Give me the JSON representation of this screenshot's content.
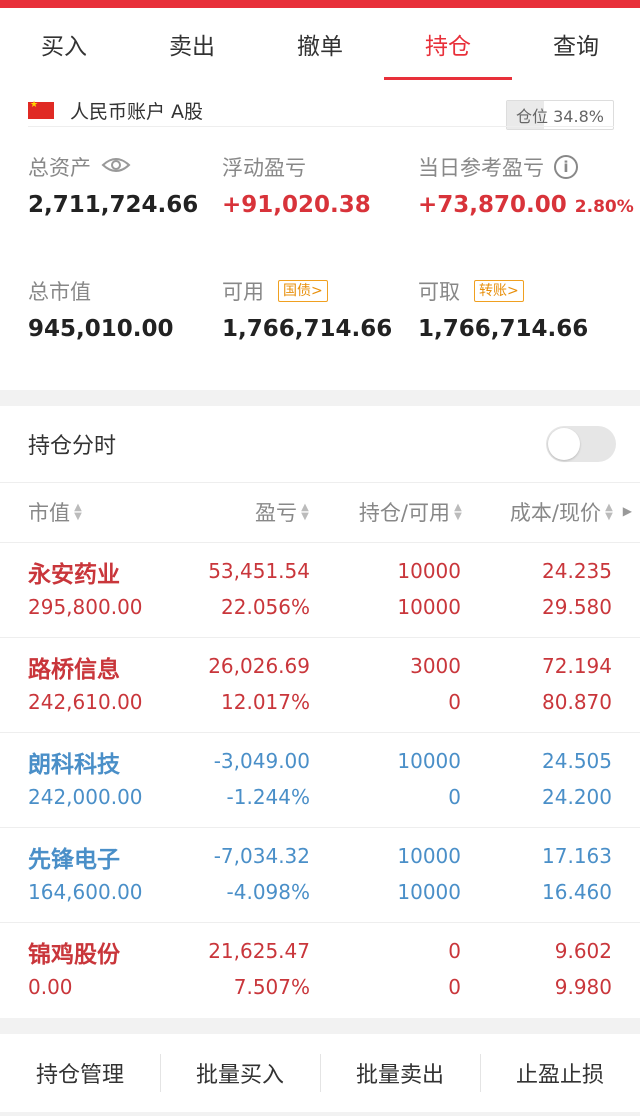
{
  "tabs": [
    {
      "label": "买入",
      "active": false
    },
    {
      "label": "卖出",
      "active": false
    },
    {
      "label": "撤单",
      "active": false
    },
    {
      "label": "持仓",
      "active": true
    },
    {
      "label": "查询",
      "active": false
    }
  ],
  "account": {
    "name": "人民币账户 A股",
    "position_label": "仓位 34.8%",
    "position_ratio": 0.348,
    "total_assets_label": "总资产",
    "total_assets": "2,711,724.66",
    "floating_pl_label": "浮动盈亏",
    "floating_pl": "+91,020.38",
    "today_pl_label": "当日参考盈亏",
    "today_pl": "+73,870.00",
    "today_pl_pct": "2.80%",
    "market_value_label": "总市值",
    "market_value": "945,010.00",
    "available_label": "可用",
    "available_chip": "国债>",
    "available": "1,766,714.66",
    "withdrawable_label": "可取",
    "withdrawable_chip": "转账>",
    "withdrawable": "1,766,714.66"
  },
  "holdings_time": {
    "label": "持仓分时",
    "enabled": false
  },
  "table": {
    "headers": [
      "市值",
      "盈亏",
      "持仓/可用",
      "成本/现价"
    ],
    "rows": [
      {
        "name": "永安药业",
        "market_value": "295,800.00",
        "pl": "53,451.54",
        "pl_pct": "22.056%",
        "holding": "10000",
        "available": "10000",
        "cost": "24.235",
        "price": "29.580",
        "color": "red"
      },
      {
        "name": "路桥信息",
        "market_value": "242,610.00",
        "pl": "26,026.69",
        "pl_pct": "12.017%",
        "holding": "3000",
        "available": "0",
        "cost": "72.194",
        "price": "80.870",
        "color": "red"
      },
      {
        "name": "朗科科技",
        "market_value": "242,000.00",
        "pl": "-3,049.00",
        "pl_pct": "-1.244%",
        "holding": "10000",
        "available": "0",
        "cost": "24.505",
        "price": "24.200",
        "color": "blue"
      },
      {
        "name": "先锋电子",
        "market_value": "164,600.00",
        "pl": "-7,034.32",
        "pl_pct": "-4.098%",
        "holding": "10000",
        "available": "10000",
        "cost": "17.163",
        "price": "16.460",
        "color": "blue"
      },
      {
        "name": "锦鸡股份",
        "market_value": "0.00",
        "pl": "21,625.47",
        "pl_pct": "7.507%",
        "holding": "0",
        "available": "0",
        "cost": "9.602",
        "price": "9.980",
        "color": "red"
      }
    ]
  },
  "bottom_bar": [
    "持仓管理",
    "批量买入",
    "批量卖出",
    "止盈止损"
  ],
  "colors": {
    "accent": "#e8303a",
    "gain": "#c9363b",
    "loss": "#4a8fc8"
  },
  "icons": {
    "visibility": "eye-icon",
    "info": "info-icon",
    "flag": "china-flag-icon"
  }
}
